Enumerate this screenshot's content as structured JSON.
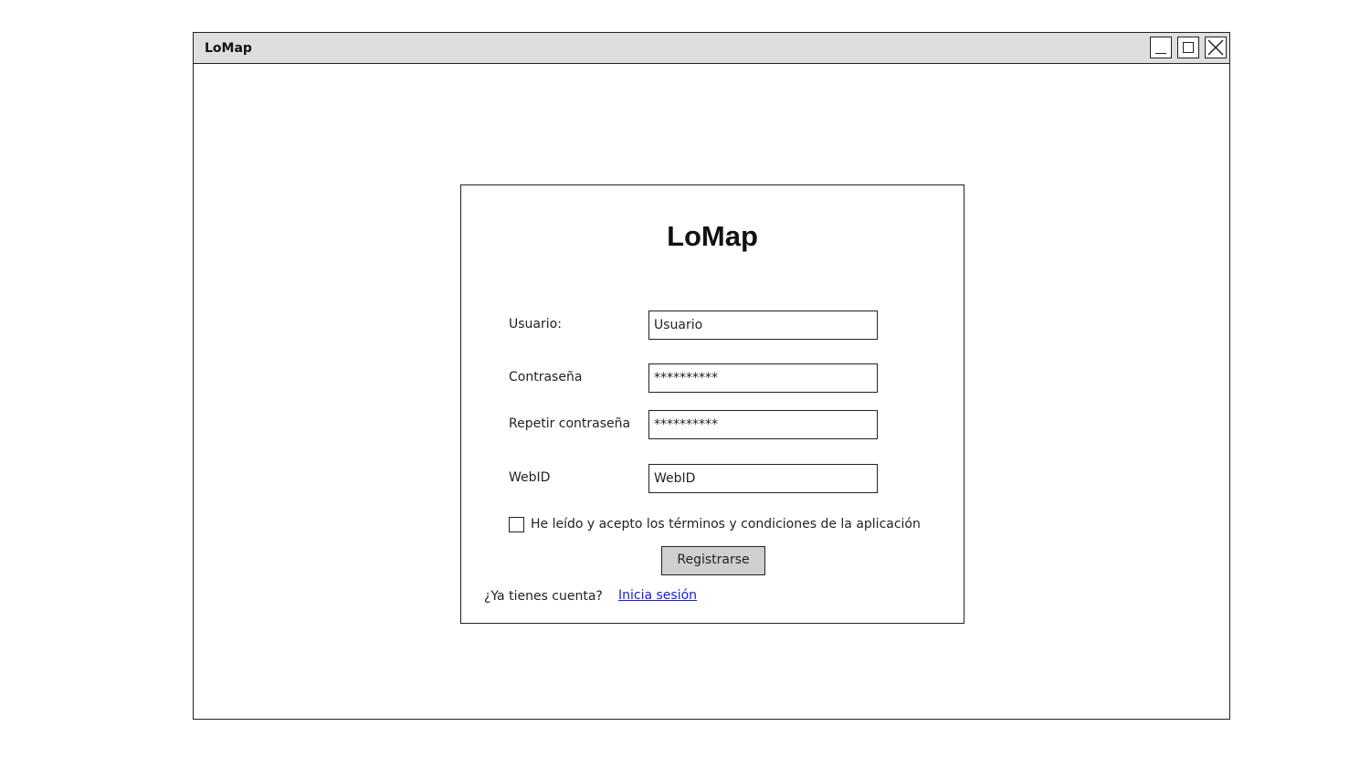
{
  "window": {
    "title": "LoMap"
  },
  "form": {
    "title": "LoMap",
    "fields": [
      {
        "label": "Usuario:",
        "value": "Usuario"
      },
      {
        "label": "Contraseña",
        "value": "**********"
      },
      {
        "label": "Repetir contraseña",
        "value": "**********"
      },
      {
        "label": "WebID",
        "value": "WebID"
      }
    ],
    "terms_label": "He leído y acepto los términos y condiciones de la aplicación",
    "terms_checked": false,
    "submit_label": "Registrarse",
    "login_prompt": "¿Ya tienes cuenta?",
    "login_link": "Inicia sesión"
  },
  "colors": {
    "titlebar_bg": "#dedede",
    "button_bg": "#cfcfcf",
    "link": "#1a1adc"
  },
  "icons": {
    "minimize": "minimize-icon",
    "maximize": "maximize-icon",
    "close": "close-icon"
  }
}
